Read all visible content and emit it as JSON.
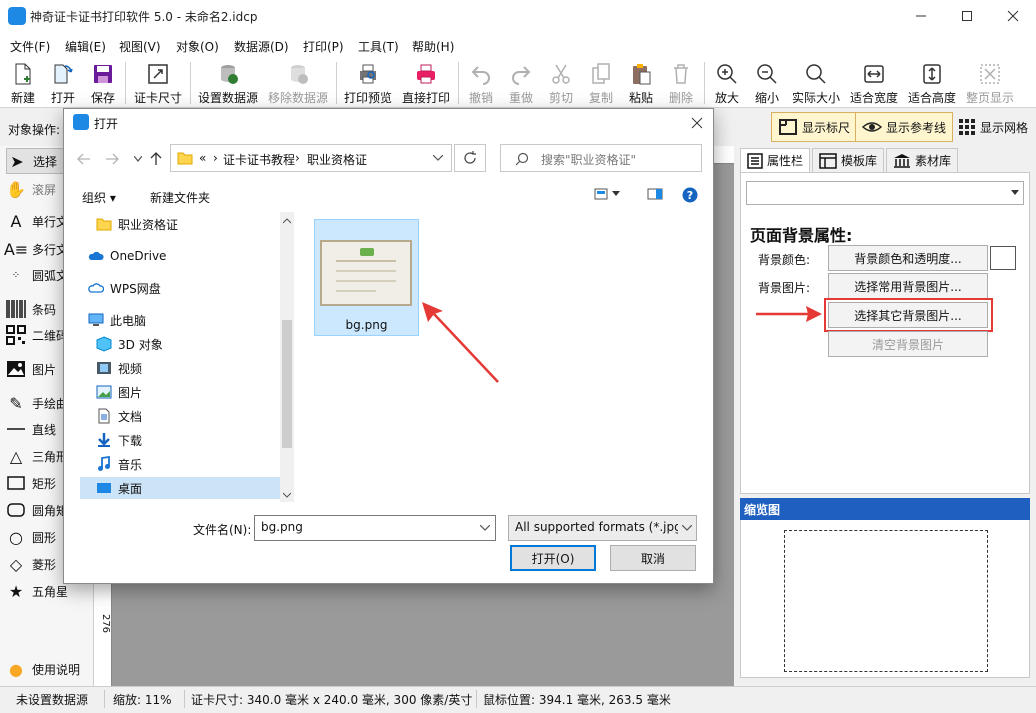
{
  "app": {
    "title": "神奇证卡证书打印软件 5.0 - 未命名2.idcp",
    "menu": [
      "文件(F)",
      "编辑(E)",
      "视图(V)",
      "对象(O)",
      "数据源(D)",
      "打印(P)",
      "工具(T)",
      "帮助(H)"
    ]
  },
  "toolbar": {
    "new": "新建",
    "open": "打开",
    "save": "保存",
    "card_size": "证卡尺寸",
    "set_data": "设置数据源",
    "remove_data": "移除数据源",
    "print_preview": "打印预览",
    "direct_print": "直接打印",
    "undo": "撤销",
    "redo": "重做",
    "cut": "剪切",
    "copy": "复制",
    "paste": "粘贴",
    "delete": "删除",
    "zoom_in": "放大",
    "zoom_out": "缩小",
    "actual_size": "实际大小",
    "fit_width": "适合宽度",
    "fit_height": "适合高度",
    "whole_page": "整页显示"
  },
  "opsbar": {
    "label": "对象操作:",
    "show_ruler": "显示标尺",
    "show_guides": "显示参考线",
    "show_grid": "显示网格"
  },
  "tools": [
    {
      "label": "选择",
      "icon": "cursor-arrow-icon"
    },
    {
      "label": "滚屏",
      "icon": "hand-icon"
    },
    {
      "label": "单行文",
      "icon": "single-line-text-icon"
    },
    {
      "label": "多行文",
      "icon": "multi-line-text-icon"
    },
    {
      "label": "圆弧文",
      "icon": "arc-text-icon"
    },
    {
      "label": "条码",
      "icon": "barcode-icon"
    },
    {
      "label": "二维码",
      "icon": "qrcode-icon"
    },
    {
      "label": "图片",
      "icon": "image-icon"
    },
    {
      "label": "手绘曲",
      "icon": "pen-icon"
    },
    {
      "label": "直线",
      "icon": "line-icon"
    },
    {
      "label": "三角形",
      "icon": "triangle-icon"
    },
    {
      "label": "矩形",
      "icon": "rectangle-icon"
    },
    {
      "label": "圆角矩",
      "icon": "rounded-rectangle-icon"
    },
    {
      "label": "圆形",
      "icon": "circle-icon"
    },
    {
      "label": "菱形",
      "icon": "diamond-icon"
    },
    {
      "label": "五角星",
      "icon": "star-icon"
    }
  ],
  "help": "使用说明",
  "ruler_mark": "276",
  "right_panel": {
    "tabs": [
      "属性栏",
      "模板库",
      "素材库"
    ],
    "heading": "页面背景属性:",
    "bg_color_label": "背景颜色:",
    "bg_color_button": "背景颜色和透明度...",
    "bg_image_label": "背景图片:",
    "common_bg_button": "选择常用背景图片...",
    "other_bg_button": "选择其它背景图片...",
    "clear_bg_button": "清空背景图片",
    "preview_title": "缩览图"
  },
  "status": {
    "datasource": "未设置数据源",
    "zoom": "缩放: 11%",
    "card_size": "证卡尺寸: 340.0 毫米 x 240.0 毫米, 300 像素/英寸",
    "mouse_pos": "鼠标位置: 394.1 毫米, 263.5 毫米"
  },
  "dialog": {
    "title": "打开",
    "path": [
      "«",
      "证卡证书教程",
      "职业资格证"
    ],
    "search_placeholder": "搜索\"职业资格证\"",
    "organize": "组织 ▾",
    "new_folder": "新建文件夹",
    "nav_items": [
      {
        "label": "职业资格证",
        "icon": "folder-icon"
      },
      {
        "label": "OneDrive",
        "icon": "cloud-icon"
      },
      {
        "label": "WPS网盘",
        "icon": "wps-cloud-icon"
      },
      {
        "label": "此电脑",
        "icon": "computer-icon"
      },
      {
        "label": "3D 对象",
        "icon": "3d-object-icon"
      },
      {
        "label": "视频",
        "icon": "video-icon"
      },
      {
        "label": "图片",
        "icon": "pictures-icon"
      },
      {
        "label": "文档",
        "icon": "document-icon"
      },
      {
        "label": "下载",
        "icon": "download-icon"
      },
      {
        "label": "音乐",
        "icon": "music-icon"
      },
      {
        "label": "桌面",
        "icon": "desktop-icon"
      }
    ],
    "file": {
      "name": "bg.png"
    },
    "filename_label": "文件名(N):",
    "filename_value": "bg.png",
    "filetype_value": "All supported formats (*.jpg;",
    "open_button": "打开(O)",
    "cancel_button": "取消"
  },
  "colors": {
    "accent_blue": "#1e88e5",
    "highlight_red": "#e53935",
    "preview_header": "#1f5fbf",
    "selection": "#cce8ff"
  }
}
